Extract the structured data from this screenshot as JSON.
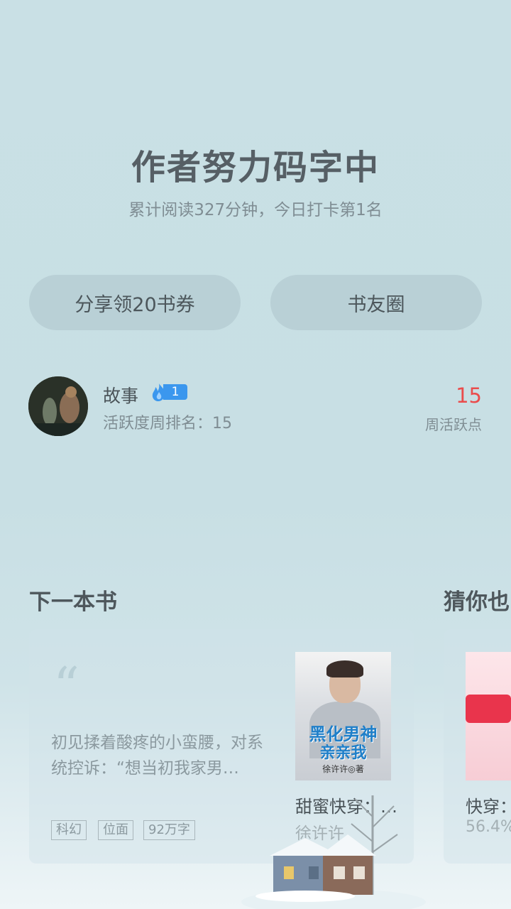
{
  "hero": {
    "title": "作者努力码字中",
    "subtitle": "累计阅读327分钟，今日打卡第1名"
  },
  "actions": {
    "share_label": "分享领20书券",
    "circle_label": "书友圈"
  },
  "user": {
    "name": "故事",
    "level": "1",
    "rank_text": "活跃度周排名：15",
    "points_value": "15",
    "points_label": "周活跃点"
  },
  "next_book": {
    "section_title": "下一本书",
    "quote_mark": "“",
    "excerpt": "初见揉着酸疼的小蛮腰，对系统控诉：“想当初我家男…",
    "tags": [
      "科幻",
      "位面",
      "92万字"
    ],
    "cover_title_a": "黑化男神",
    "cover_title_b": "亲亲我",
    "cover_author": "徐许许◎著",
    "title": "甜蜜快穿：…",
    "author": "徐许许"
  },
  "guess": {
    "section_title": "猜你也",
    "title": "快穿：",
    "progress": "56.4%"
  },
  "colors": {
    "accent_red": "#ea4c4c",
    "badge_blue": "#3b97ee"
  }
}
